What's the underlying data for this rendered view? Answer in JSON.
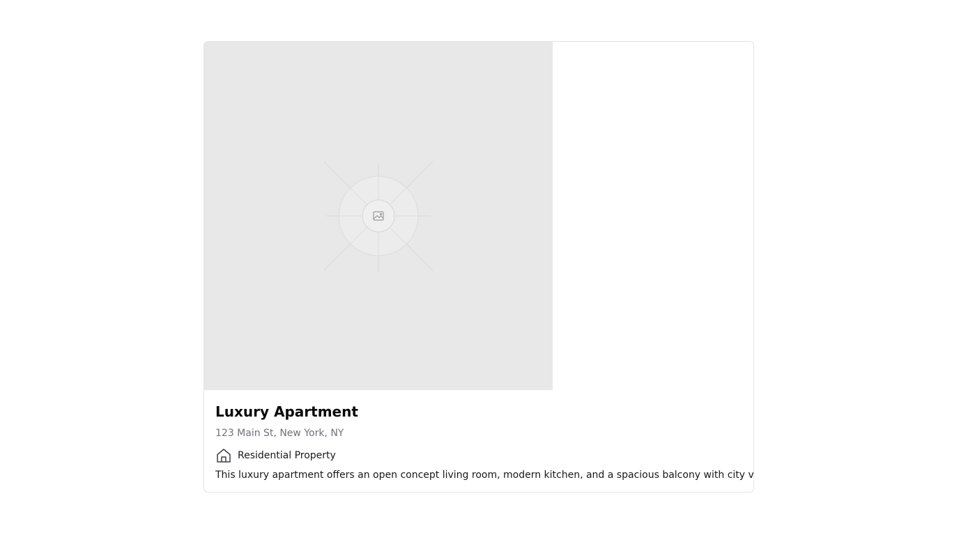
{
  "card": {
    "image": {
      "icon": "image-icon"
    },
    "title": "Luxury Apartment",
    "address": "123 Main St, New York, NY",
    "property_type": {
      "icon": "home-icon",
      "label": "Residential Property"
    },
    "description": "This luxury apartment offers an open concept living room, modern kitchen, and a spacious balcony with city views."
  },
  "colors": {
    "placeholder_bg": "#e8e8e8",
    "border": "#e4e4e7",
    "muted_text": "#71717a",
    "text": "#18181b"
  }
}
